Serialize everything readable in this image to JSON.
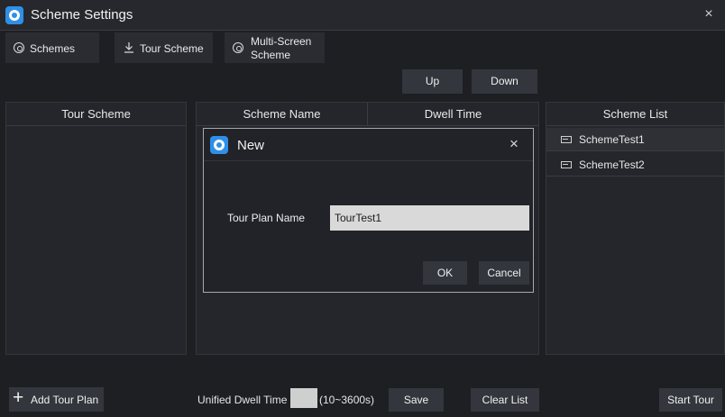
{
  "window": {
    "title": "Scheme Settings",
    "close_glyph": "×"
  },
  "tabs": [
    {
      "label": "Schemes",
      "icon": "scheme-icon"
    },
    {
      "label": "Tour Scheme",
      "icon": "download-arrow-icon"
    },
    {
      "label": "Multi-Screen",
      "label_line2": "Scheme",
      "icon": "multi-screen-icon"
    }
  ],
  "order_buttons": {
    "up": "Up",
    "down": "Down"
  },
  "tour_panel": {
    "header": "Tour Scheme"
  },
  "details_panel": {
    "col_name": "Scheme Name",
    "col_dwell": "Dwell Time"
  },
  "scheme_list": {
    "header": "Scheme List",
    "items": [
      {
        "label": "SchemeTest1"
      },
      {
        "label": "SchemeTest2"
      }
    ]
  },
  "dialog": {
    "title": "New",
    "close_glyph": "×",
    "field_label": "Tour Plan Name",
    "field_value": "TourTest1",
    "ok": "OK",
    "cancel": "Cancel"
  },
  "footer": {
    "add_plus": "+",
    "add_label": "Add Tour Plan",
    "dwell_label": "Unified Dwell Time",
    "dwell_range": "(10~3600s)",
    "save": "Save",
    "clear": "Clear List",
    "start": "Start Tour"
  },
  "colors": {
    "accent": "#2f8fe8",
    "background": "#1d1f23",
    "panel": "#24262b",
    "button": "#33363c"
  }
}
